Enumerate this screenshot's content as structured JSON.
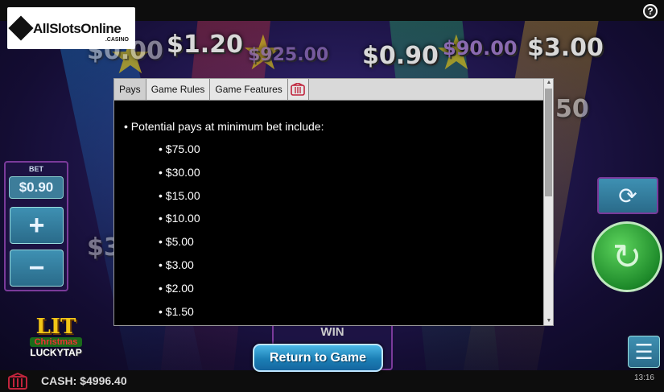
{
  "site_logo": {
    "text": "AllSlotsOnline",
    "sub": ".CASINO"
  },
  "help_icon": "?",
  "background_values": [
    "$0.00",
    "$1.20",
    "$925.00",
    "$0.90",
    "$90.00",
    "$3.00",
    "$30",
    "50"
  ],
  "bet": {
    "label": "BET",
    "value": "$0.90",
    "plus": "+",
    "minus": "−"
  },
  "game_logo": {
    "line1": "LIT",
    "line2": "Christmas",
    "line3": "LUCKYTAP"
  },
  "win": {
    "label": "WIN"
  },
  "modal": {
    "tabs": [
      {
        "label": "Pays",
        "active": true
      },
      {
        "label": "Game Rules",
        "active": false
      },
      {
        "label": "Game Features",
        "active": false
      }
    ],
    "intro": "• Potential pays at minimum bet include:",
    "pays": [
      "• $75.00",
      "• $30.00",
      "• $15.00",
      "• $10.00",
      "• $5.00",
      "• $3.00",
      "• $2.00",
      "• $1.50"
    ]
  },
  "return_button": "Return to Game",
  "cash": "CASH: $4996.40",
  "clock": "13:16",
  "colors": {
    "accent": "#1b7fb5",
    "spin": "#1e8a2a",
    "panel_border": "#7a3a9a"
  }
}
